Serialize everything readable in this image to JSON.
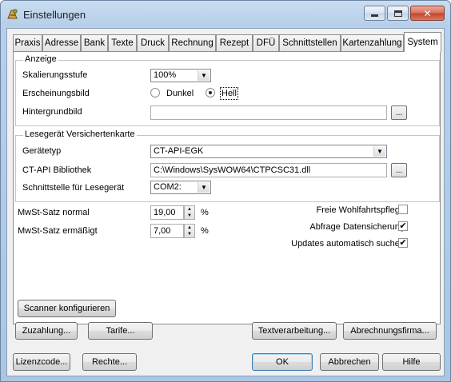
{
  "window": {
    "title": "Einstellungen",
    "close_glyph": "✕"
  },
  "tabs": [
    "Praxis",
    "Adresse",
    "Bank",
    "Texte",
    "Druck",
    "Rechnung",
    "Rezept",
    "DFÜ",
    "Schnittstellen",
    "Kartenzahlung",
    "System"
  ],
  "active_tab": "System",
  "anzeige": {
    "legend": "Anzeige",
    "skalierung_label": "Skalierungsstufe",
    "skalierung_value": "100%",
    "erscheinung_label": "Erscheinungsbild",
    "radio_dunkel": "Dunkel",
    "radio_hell": "Hell",
    "selected": "Hell",
    "hintergrund_label": "Hintergrundbild",
    "hintergrund_value": ""
  },
  "lesegeraet": {
    "legend": "Lesegerät Versichertenkarte",
    "typ_label": "Gerätetyp",
    "typ_value": "CT-API-EGK",
    "bibliothek_label": "CT-API Bibliothek",
    "bibliothek_value": "C:\\Windows\\SysWOW64\\CTPCSC31.dll",
    "schnittstelle_label": "Schnittstelle für Lesegerät",
    "schnittstelle_value": "COM2:"
  },
  "mwst": {
    "normal_label": "MwSt-Satz normal",
    "normal_value": "19,00",
    "ermaessigt_label": "MwSt-Satz ermäßigt",
    "ermaessigt_value": "7,00",
    "unit": "%"
  },
  "options": [
    {
      "label": "Freie Wohlfahrtspflege",
      "checked": false
    },
    {
      "label": "Abfrage Datensicherung",
      "checked": true
    },
    {
      "label": "Updates automatisch suchen",
      "checked": true
    }
  ],
  "buttons": {
    "scanner": "Scanner konfigurieren",
    "zuzahlung": "Zuzahlung...",
    "tarife": "Tarife...",
    "textverarbeitung": "Textverarbeitung...",
    "abrechnungsfirma": "Abrechnungsfirma...",
    "lizenzcode": "Lizenzcode...",
    "rechte": "Rechte...",
    "ok": "OK",
    "abbrechen": "Abbrechen",
    "hilfe": "Hilfe"
  },
  "glyphs": {
    "browse": "...",
    "dropdown": "▼",
    "spin_up": "▲",
    "spin_down": "▼",
    "check": "✔"
  },
  "colors": {
    "titlebar": "#b7cfe9",
    "close_button": "#c2452a",
    "default_button_border": "#3c7fb1"
  }
}
